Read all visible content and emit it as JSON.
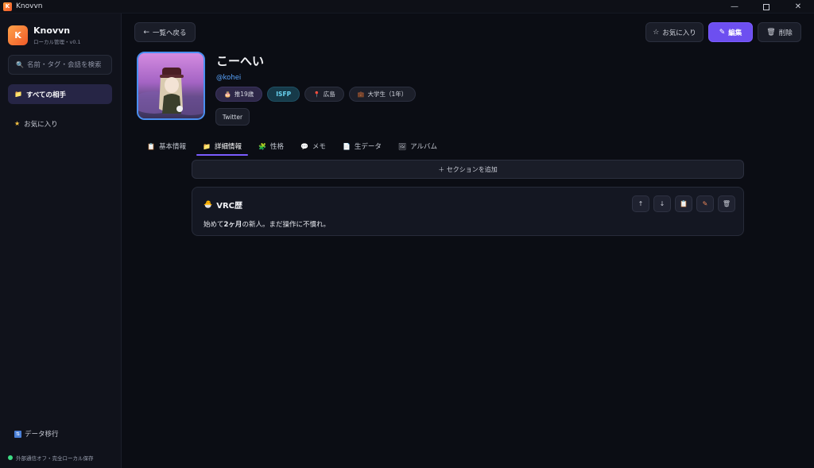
{
  "window": {
    "title": "Knovvn",
    "app_letter": "K"
  },
  "sidebar": {
    "app_name": "Knovvn",
    "app_sub": "ローカル管理・v0.1",
    "search_placeholder": "名前・タグ・会話を検索",
    "nav": [
      {
        "label": "すべての相手",
        "icon": "folder-icon",
        "active": true
      },
      {
        "label": "お気に入り",
        "icon": "star-icon",
        "active": false
      }
    ],
    "migrate_label": "データ移行",
    "status_text": "外部通信オフ・完全ローカル保存"
  },
  "toolbar": {
    "back_label": "一覧へ戻る",
    "fav_label": "お気に入り",
    "edit_label": "編集",
    "delete_label": "削除"
  },
  "profile": {
    "name": "こーへい",
    "handle": "@kohei",
    "tags": {
      "age": "推19歳",
      "mbti": "ISFP",
      "location": "広島",
      "occupation": "大学生（1年）"
    },
    "link": "Twitter"
  },
  "tabs": [
    {
      "label": "基本情報",
      "icon": "clipboard-icon"
    },
    {
      "label": "詳細情報",
      "icon": "folder-icon"
    },
    {
      "label": "性格",
      "icon": "puzzle-icon"
    },
    {
      "label": "メモ",
      "icon": "speech-bubble-icon"
    },
    {
      "label": "生データ",
      "icon": "document-icon"
    },
    {
      "label": "アルバム",
      "icon": "image-icon"
    }
  ],
  "active_tab": "詳細情報",
  "add_section_label": "＋ セクションを追加",
  "section": {
    "title": "VRC歴",
    "body_prefix": "始めて",
    "body_bold": "2ヶ月",
    "body_suffix": "の新人。まだ操作に不慣れ。"
  }
}
